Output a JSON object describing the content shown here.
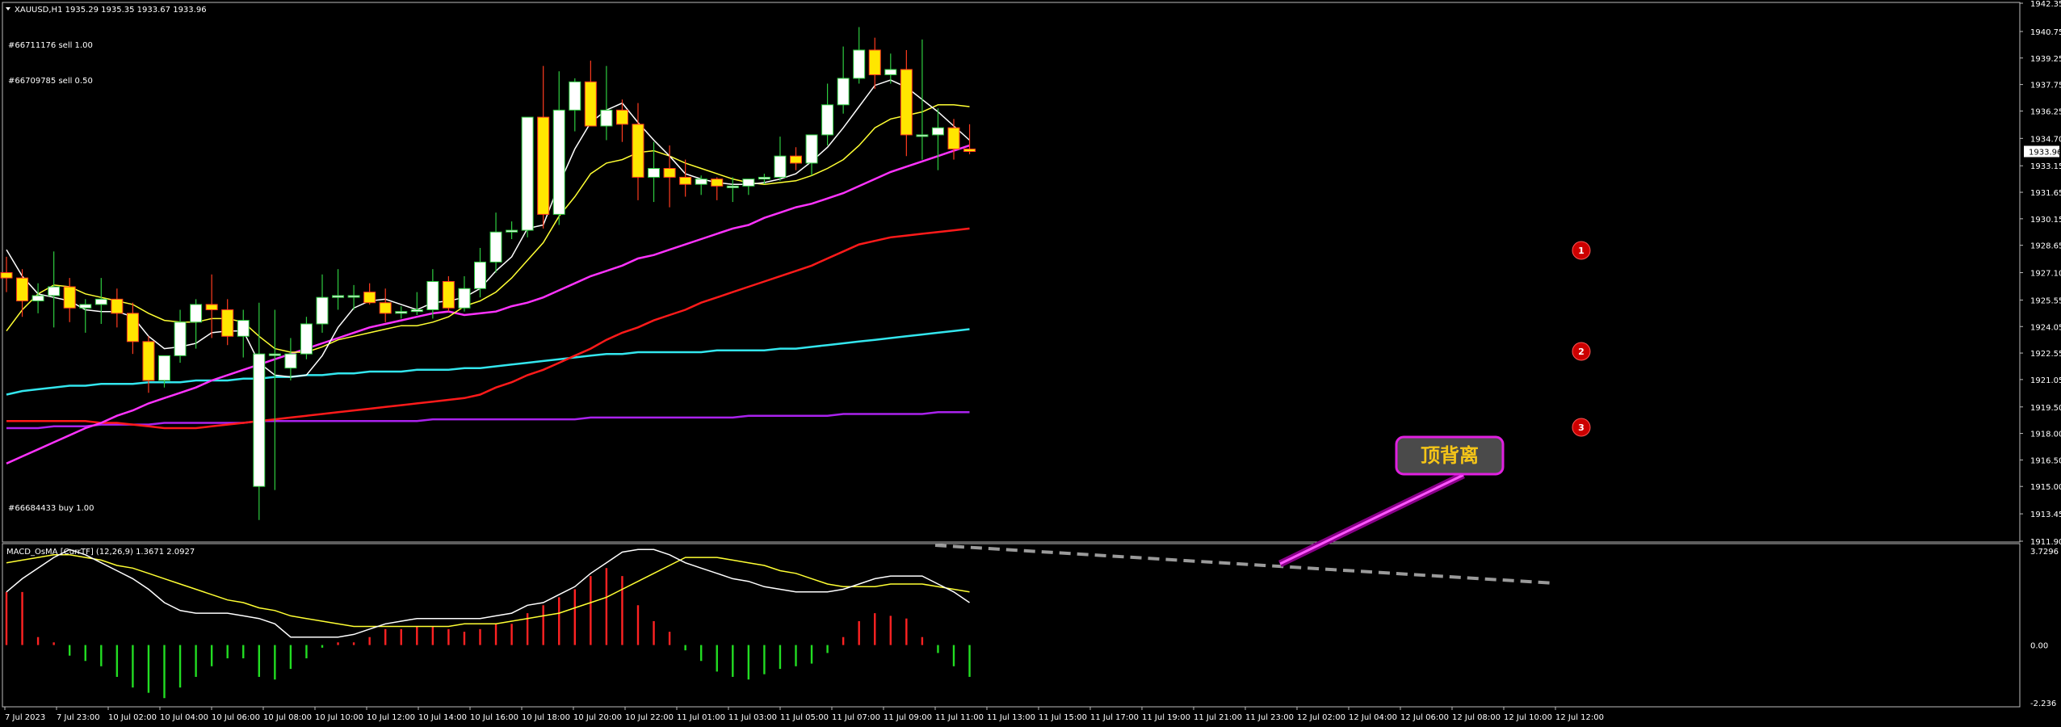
{
  "window": {
    "menu_icon": "triangle-down-icon"
  },
  "header": {
    "symbol_info": "XAUUSD,H1  1935.29 1935.35 1933.67 1933.96",
    "order_sell_1": "#66711176 sell 1.00",
    "order_sell_2": "#66709785 sell 0.50",
    "order_buy": "#66684433 buy 1.00"
  },
  "indicator": {
    "label": "MACD_OsMA [CurrTF] (12,26,9) 1.3671 2.0927"
  },
  "annotation": {
    "text": "顶背离"
  },
  "markers": [
    "1",
    "2",
    "3"
  ],
  "price_axis": {
    "labels": [
      "1942.35",
      "1940.75",
      "1939.25",
      "1937.75",
      "1936.25",
      "1934.70",
      "1933.96",
      "1933.15",
      "1931.65",
      "1930.15",
      "1928.65",
      "1927.10",
      "1925.55",
      "1924.05",
      "1922.55",
      "1921.05",
      "1919.50",
      "1918.00",
      "1916.50",
      "1915.00",
      "1913.45",
      "1911.90"
    ],
    "current": "1933.96"
  },
  "macd_axis": {
    "labels": [
      "3.7296",
      "0.00",
      "-2.236"
    ]
  },
  "time_axis": {
    "labels": [
      "7 Jul 2023",
      "7 Jul 23:00",
      "10 Jul 02:00",
      "10 Jul 04:00",
      "10 Jul 06:00",
      "10 Jul 08:00",
      "10 Jul 10:00",
      "10 Jul 12:00",
      "10 Jul 14:00",
      "10 Jul 16:00",
      "10 Jul 18:00",
      "10 Jul 20:00",
      "10 Jul 22:00",
      "11 Jul 01:00",
      "11 Jul 03:00",
      "11 Jul 05:00",
      "11 Jul 07:00",
      "11 Jul 09:00",
      "11 Jul 11:00",
      "11 Jul 13:00",
      "11 Jul 15:00",
      "11 Jul 17:00",
      "11 Jul 19:00",
      "11 Jul 21:00",
      "11 Jul 23:00",
      "12 Jul 02:00",
      "12 Jul 04:00",
      "12 Jul 06:00",
      "12 Jul 08:00",
      "12 Jul 10:00",
      "12 Jul 12:00"
    ]
  },
  "colors": {
    "background": "#000000",
    "bull": "#ffffff",
    "bear": "#ffe600",
    "wick_up": "#2ecc40",
    "wick_down": "#ff3b1f",
    "ma_fast": "#ffffff",
    "ma_mid": "#ffff33",
    "ma_slow": "#ff33ff",
    "ma_red": "#ff1a1a",
    "ma_cyan": "#33e6ee",
    "ma_purple": "#aa22ee",
    "hist_pos": "#ff2222",
    "hist_neg": "#22dd22",
    "marker": "#cc0000",
    "callout_border": "#e020e0",
    "callout_text": "#f5c518",
    "divergence": "#9a9a9a"
  },
  "chart_data": [
    {
      "type": "candlestick",
      "title": "XAUUSD,H1",
      "ylim": [
        1911.9,
        1942.35
      ],
      "x": [
        "7 Jul 22:00",
        "7 Jul 23:00",
        "8 Jul 00:00",
        "10 Jul 01:00",
        "10 Jul 02:00",
        "10 Jul 03:00",
        "10 Jul 04:00",
        "10 Jul 05:00",
        "10 Jul 06:00",
        "10 Jul 07:00",
        "10 Jul 08:00",
        "10 Jul 09:00",
        "10 Jul 10:00",
        "10 Jul 11:00",
        "10 Jul 12:00",
        "10 Jul 13:00",
        "10 Jul 14:00",
        "10 Jul 15:00",
        "10 Jul 16:00",
        "10 Jul 17:00",
        "10 Jul 18:00",
        "10 Jul 19:00",
        "10 Jul 20:00",
        "10 Jul 21:00",
        "10 Jul 22:00",
        "10 Jul 23:00",
        "11 Jul 00:00",
        "11 Jul 01:00",
        "11 Jul 02:00",
        "11 Jul 03:00",
        "11 Jul 04:00",
        "11 Jul 05:00",
        "11 Jul 06:00",
        "11 Jul 07:00",
        "11 Jul 08:00",
        "11 Jul 09:00",
        "11 Jul 10:00",
        "11 Jul 11:00",
        "11 Jul 12:00",
        "11 Jul 13:00",
        "11 Jul 14:00",
        "11 Jul 15:00",
        "11 Jul 16:00",
        "11 Jul 17:00",
        "11 Jul 18:00",
        "11 Jul 19:00",
        "11 Jul 20:00",
        "11 Jul 21:00",
        "11 Jul 22:00",
        "11 Jul 23:00",
        "12 Jul 00:00",
        "12 Jul 01:00",
        "12 Jul 02:00",
        "12 Jul 03:00",
        "12 Jul 04:00",
        "12 Jul 05:00",
        "12 Jul 06:00",
        "12 Jul 07:00",
        "12 Jul 08:00",
        "12 Jul 09:00",
        "12 Jul 10:00",
        "12 Jul 11:00"
      ],
      "open": [
        1927.1,
        1926.8,
        1925.5,
        1925.8,
        1926.3,
        1925.1,
        1925.3,
        1925.6,
        1924.8,
        1923.2,
        1921.0,
        1922.4,
        1924.3,
        1925.3,
        1925.0,
        1923.5,
        1915.0,
        1922.5,
        1921.7,
        1922.5,
        1924.2,
        1925.7,
        1925.8,
        1926.0,
        1925.4,
        1924.8,
        1924.9,
        1925.0,
        1926.6,
        1925.1,
        1926.2,
        1927.7,
        1929.4,
        1929.5,
        1935.9,
        1930.4,
        1936.3,
        1937.9,
        1935.4,
        1936.3,
        1935.5,
        1932.5,
        1933.0,
        1932.5,
        1932.1,
        1932.4,
        1932.0,
        1932.0,
        1932.4,
        1932.5,
        1933.7,
        1933.3,
        1934.9,
        1936.6,
        1938.1,
        1939.7,
        1938.3,
        1938.6,
        1934.9,
        1934.9,
        1935.3,
        1934.1
      ],
      "high": [
        1928.0,
        1927.3,
        1926.5,
        1928.3,
        1926.8,
        1925.6,
        1926.8,
        1926.2,
        1925.4,
        1923.5,
        1921.7,
        1925.0,
        1925.6,
        1927.0,
        1925.6,
        1925.0,
        1925.4,
        1925.0,
        1923.4,
        1924.6,
        1927.0,
        1927.3,
        1926.4,
        1926.5,
        1926.2,
        1925.2,
        1926.0,
        1927.3,
        1926.9,
        1926.9,
        1928.5,
        1930.5,
        1930.0,
        1930.8,
        1938.8,
        1938.5,
        1938.1,
        1939.1,
        1938.8,
        1936.9,
        1936.7,
        1934.5,
        1934.3,
        1933.5,
        1932.6,
        1932.5,
        1932.5,
        1932.3,
        1932.7,
        1934.8,
        1934.2,
        1934.6,
        1937.8,
        1939.9,
        1941.0,
        1940.4,
        1939.5,
        1939.7,
        1940.3,
        1936.4,
        1935.8,
        1935.5
      ],
      "low": [
        1926.0,
        1924.6,
        1924.8,
        1924.0,
        1924.3,
        1923.7,
        1924.2,
        1924.0,
        1922.5,
        1920.3,
        1920.6,
        1922.0,
        1922.8,
        1923.4,
        1923.0,
        1922.3,
        1913.1,
        1914.8,
        1921.0,
        1922.2,
        1923.7,
        1925.0,
        1925.0,
        1925.3,
        1924.3,
        1924.5,
        1924.7,
        1924.5,
        1924.9,
        1924.9,
        1925.7,
        1927.1,
        1929.0,
        1929.1,
        1929.6,
        1929.8,
        1935.1,
        1937.0,
        1934.6,
        1934.5,
        1931.2,
        1931.1,
        1930.8,
        1931.4,
        1931.5,
        1931.2,
        1931.1,
        1931.5,
        1932.1,
        1932.3,
        1932.9,
        1932.6,
        1934.3,
        1936.1,
        1937.8,
        1937.5,
        1937.8,
        1933.7,
        1933.5,
        1932.9,
        1933.5,
        1933.8
      ],
      "close": [
        1926.8,
        1925.5,
        1925.8,
        1926.3,
        1925.1,
        1925.3,
        1925.6,
        1924.8,
        1923.2,
        1921.0,
        1922.4,
        1924.3,
        1925.3,
        1925.0,
        1923.5,
        1924.4,
        1922.5,
        1922.5,
        1922.5,
        1924.2,
        1925.7,
        1925.8,
        1925.8,
        1925.4,
        1924.8,
        1924.9,
        1925.0,
        1926.6,
        1925.1,
        1926.2,
        1927.7,
        1929.4,
        1929.5,
        1935.9,
        1930.4,
        1936.3,
        1937.9,
        1935.4,
        1936.3,
        1935.5,
        1932.5,
        1933.0,
        1932.5,
        1932.1,
        1932.4,
        1932.0,
        1932.0,
        1932.4,
        1932.5,
        1933.7,
        1933.3,
        1934.9,
        1936.6,
        1938.1,
        1939.7,
        1938.3,
        1938.6,
        1934.9,
        1934.9,
        1935.3,
        1934.1,
        1933.96
      ],
      "ma_fast": [
        1928.4,
        1926.9,
        1925.9,
        1925.7,
        1925.5,
        1925.0,
        1924.9,
        1924.9,
        1924.6,
        1923.5,
        1922.8,
        1922.9,
        1923.1,
        1923.7,
        1923.8,
        1923.8,
        1922.0,
        1921.3,
        1921.2,
        1921.3,
        1922.4,
        1924.0,
        1925.1,
        1925.5,
        1925.6,
        1925.3,
        1925.0,
        1925.4,
        1925.5,
        1925.7,
        1926.2,
        1927.2,
        1928.0,
        1929.6,
        1929.8,
        1932.1,
        1934.1,
        1935.6,
        1936.3,
        1936.7,
        1935.6,
        1934.6,
        1933.7,
        1932.7,
        1932.4,
        1932.2,
        1932.1,
        1932.1,
        1932.2,
        1932.4,
        1932.7,
        1933.4,
        1934.2,
        1935.3,
        1936.5,
        1937.7,
        1938.0,
        1937.6,
        1936.9,
        1936.2,
        1935.4,
        1934.6
      ],
      "ma_mid": [
        1923.8,
        1925.0,
        1925.9,
        1926.4,
        1926.3,
        1925.9,
        1925.7,
        1925.5,
        1925.3,
        1924.8,
        1924.4,
        1924.3,
        1924.3,
        1924.5,
        1924.5,
        1924.3,
        1923.5,
        1922.8,
        1922.6,
        1922.6,
        1922.9,
        1923.3,
        1923.5,
        1923.7,
        1923.9,
        1924.1,
        1924.1,
        1924.3,
        1924.6,
        1925.2,
        1925.5,
        1926.0,
        1926.8,
        1927.8,
        1928.8,
        1930.3,
        1931.4,
        1932.7,
        1933.3,
        1933.5,
        1933.9,
        1934.0,
        1933.7,
        1933.3,
        1933.0,
        1932.7,
        1932.4,
        1932.2,
        1932.1,
        1932.2,
        1932.3,
        1932.6,
        1933.0,
        1933.5,
        1934.3,
        1935.3,
        1935.8,
        1936.0,
        1936.2,
        1936.6,
        1936.6,
        1936.5
      ],
      "ma_slow": [
        1916.3,
        1916.7,
        1917.1,
        1917.5,
        1917.9,
        1918.3,
        1918.6,
        1919.0,
        1919.3,
        1919.7,
        1920.0,
        1920.3,
        1920.6,
        1921.0,
        1921.3,
        1921.6,
        1921.9,
        1922.2,
        1922.5,
        1922.8,
        1923.1,
        1923.4,
        1923.7,
        1924.0,
        1924.2,
        1924.4,
        1924.6,
        1924.8,
        1924.9,
        1924.7,
        1924.8,
        1924.9,
        1925.2,
        1925.4,
        1925.7,
        1926.1,
        1926.5,
        1926.9,
        1927.2,
        1927.5,
        1927.9,
        1928.1,
        1928.4,
        1928.7,
        1929.0,
        1929.3,
        1929.6,
        1929.8,
        1930.2,
        1930.5,
        1930.8,
        1931.0,
        1931.3,
        1931.6,
        1932.0,
        1932.4,
        1932.8,
        1933.1,
        1933.4,
        1933.7,
        1934.0,
        1934.3
      ],
      "ma_red": [
        1918.7,
        1918.7,
        1918.7,
        1918.7,
        1918.7,
        1918.7,
        1918.6,
        1918.6,
        1918.5,
        1918.4,
        1918.3,
        1918.3,
        1918.3,
        1918.4,
        1918.5,
        1918.6,
        1918.7,
        1918.8,
        1918.9,
        1919.0,
        1919.1,
        1919.2,
        1919.3,
        1919.4,
        1919.5,
        1919.6,
        1919.7,
        1919.8,
        1919.9,
        1920.0,
        1920.2,
        1920.6,
        1920.9,
        1921.3,
        1921.6,
        1922.0,
        1922.4,
        1922.8,
        1923.3,
        1923.7,
        1924.0,
        1924.4,
        1924.7,
        1925.0,
        1925.4,
        1925.7,
        1926.0,
        1926.3,
        1926.6,
        1926.9,
        1927.2,
        1927.5,
        1927.9,
        1928.3,
        1928.7,
        1928.9,
        1929.1,
        1929.2,
        1929.3,
        1929.4,
        1929.5,
        1929.6
      ],
      "ma_cyan": [
        1920.2,
        1920.4,
        1920.5,
        1920.6,
        1920.7,
        1920.7,
        1920.8,
        1920.8,
        1920.8,
        1920.9,
        1920.9,
        1920.9,
        1921.0,
        1921.0,
        1921.0,
        1921.1,
        1921.1,
        1921.2,
        1921.2,
        1921.3,
        1921.3,
        1921.4,
        1921.4,
        1921.5,
        1921.5,
        1921.5,
        1921.6,
        1921.6,
        1921.6,
        1921.7,
        1921.7,
        1921.8,
        1921.9,
        1922.0,
        1922.1,
        1922.2,
        1922.3,
        1922.4,
        1922.5,
        1922.5,
        1922.6,
        1922.6,
        1922.6,
        1922.6,
        1922.6,
        1922.7,
        1922.7,
        1922.7,
        1922.7,
        1922.8,
        1922.8,
        1922.9,
        1923.0,
        1923.1,
        1923.2,
        1923.3,
        1923.4,
        1923.5,
        1923.6,
        1923.7,
        1923.8,
        1923.9
      ],
      "ma_purple": [
        1918.3,
        1918.3,
        1918.3,
        1918.4,
        1918.4,
        1918.4,
        1918.5,
        1918.5,
        1918.5,
        1918.5,
        1918.6,
        1918.6,
        1918.6,
        1918.6,
        1918.6,
        1918.6,
        1918.7,
        1918.7,
        1918.7,
        1918.7,
        1918.7,
        1918.7,
        1918.7,
        1918.7,
        1918.7,
        1918.7,
        1918.7,
        1918.8,
        1918.8,
        1918.8,
        1918.8,
        1918.8,
        1918.8,
        1918.8,
        1918.8,
        1918.8,
        1918.8,
        1918.9,
        1918.9,
        1918.9,
        1918.9,
        1918.9,
        1918.9,
        1918.9,
        1918.9,
        1918.9,
        1918.9,
        1919.0,
        1919.0,
        1919.0,
        1919.0,
        1919.0,
        1919.0,
        1919.1,
        1919.1,
        1919.1,
        1919.1,
        1919.1,
        1919.1,
        1919.2,
        1919.2,
        1919.2
      ]
    },
    {
      "type": "histogram",
      "title": "MACD_OsMA [CurrTF] (12,26,9)",
      "ylim": [
        -2.236,
        3.7296
      ],
      "macd": [
        2.0,
        2.5,
        2.9,
        3.3,
        3.6,
        3.4,
        3.1,
        2.8,
        2.5,
        2.1,
        1.6,
        1.3,
        1.2,
        1.2,
        1.2,
        1.1,
        1.0,
        0.8,
        0.3,
        0.3,
        0.3,
        0.3,
        0.4,
        0.6,
        0.8,
        0.9,
        1.0,
        1.0,
        1.0,
        1.0,
        1.0,
        1.1,
        1.2,
        1.5,
        1.6,
        1.9,
        2.2,
        2.7,
        3.1,
        3.5,
        3.6,
        3.6,
        3.4,
        3.1,
        2.9,
        2.7,
        2.5,
        2.4,
        2.2,
        2.1,
        2.0,
        2.0,
        2.0,
        2.1,
        2.3,
        2.5,
        2.6,
        2.6,
        2.6,
        2.3,
        2.0,
        1.6
      ],
      "signal": [
        3.1,
        3.2,
        3.3,
        3.4,
        3.4,
        3.3,
        3.2,
        3.0,
        2.9,
        2.7,
        2.5,
        2.3,
        2.1,
        1.9,
        1.7,
        1.6,
        1.4,
        1.3,
        1.1,
        1.0,
        0.9,
        0.8,
        0.7,
        0.7,
        0.7,
        0.7,
        0.7,
        0.7,
        0.7,
        0.8,
        0.8,
        0.8,
        0.9,
        1.0,
        1.1,
        1.2,
        1.4,
        1.6,
        1.8,
        2.1,
        2.4,
        2.7,
        3.0,
        3.3,
        3.3,
        3.3,
        3.2,
        3.1,
        3.0,
        2.8,
        2.7,
        2.5,
        2.3,
        2.2,
        2.2,
        2.2,
        2.3,
        2.3,
        2.3,
        2.2,
        2.1,
        2.0
      ],
      "values": [
        2.0,
        2.0,
        0.3,
        0.1,
        -0.4,
        -0.6,
        -0.8,
        -1.2,
        -1.6,
        -1.8,
        -2.0,
        -1.6,
        -1.2,
        -0.8,
        -0.5,
        -0.5,
        -1.2,
        -1.3,
        -0.9,
        -0.5,
        -0.1,
        0.1,
        0.1,
        0.3,
        0.6,
        0.6,
        0.7,
        0.7,
        0.6,
        0.5,
        0.6,
        0.8,
        0.8,
        1.2,
        1.5,
        1.8,
        2.1,
        2.6,
        2.9,
        2.6,
        1.5,
        0.9,
        0.5,
        -0.2,
        -0.6,
        -1.0,
        -1.2,
        -1.3,
        -1.1,
        -0.9,
        -0.8,
        -0.7,
        -0.3,
        0.3,
        0.9,
        1.2,
        1.1,
        1.0,
        0.3,
        -0.3,
        -0.8,
        -1.2
      ]
    }
  ]
}
